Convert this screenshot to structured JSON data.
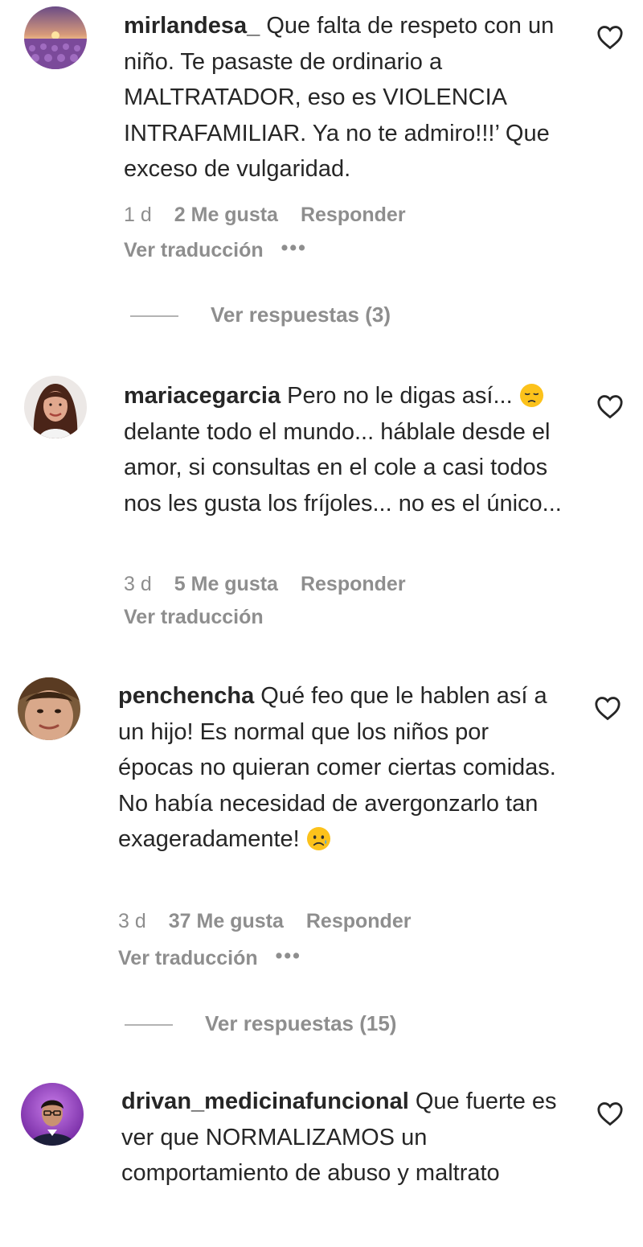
{
  "comments": [
    {
      "username": "mirlandesa_",
      "text": "Que falta de respeto con un niño. Te pasaste de ordinario a MALTRATADOR, eso es VIOLENCIA INTRAFAMILIAR. Ya no te admiro!!!’ Que exceso de vulgaridad.",
      "age": "1 d",
      "likes": "2 Me gusta",
      "reply_label": "Responder",
      "translate_label": "Ver traducción",
      "more_label": "•••",
      "view_replies": "Ver respuestas (3)",
      "avatar_icon": "lavender-field-sunset-avatar"
    },
    {
      "username": "mariacegarcia",
      "text_part1": "Pero no le digas así...",
      "emoji": "pensive-face-emoji",
      "text_part2": "delante todo el mundo... háblale desde el amor, si consultas en el cole a casi todos nos les gusta los fríjoles... no es el único...",
      "age": "3 d",
      "likes": "5 Me gusta",
      "reply_label": "Responder",
      "translate_label": "Ver traducción",
      "avatar_icon": "woman-portrait-avatar"
    },
    {
      "username": "penchencha",
      "text": "Qué feo que le hablen así a un hijo! Es normal que los niños por épocas no quieran comer ciertas comidas. No había necesidad de avergonzarlo tan exageradamente!",
      "emoji": "sad-but-relieved-face-emoji",
      "age": "3 d",
      "likes": "37 Me gusta",
      "reply_label": "Responder",
      "translate_label": "Ver traducción",
      "more_label": "•••",
      "view_replies": "Ver respuestas (15)",
      "avatar_icon": "woman-closeup-avatar"
    },
    {
      "username": "drivan_medicinafuncional",
      "text": "Que fuerte es ver que NORMALIZAMOS un comportamiento de abuso y maltrato",
      "avatar_icon": "man-purple-background-avatar"
    }
  ],
  "colors": {
    "text": "#262626",
    "secondary": "#8e8e8e",
    "divider": "#b3b3b3"
  },
  "like_icon": "heart-outline-icon"
}
